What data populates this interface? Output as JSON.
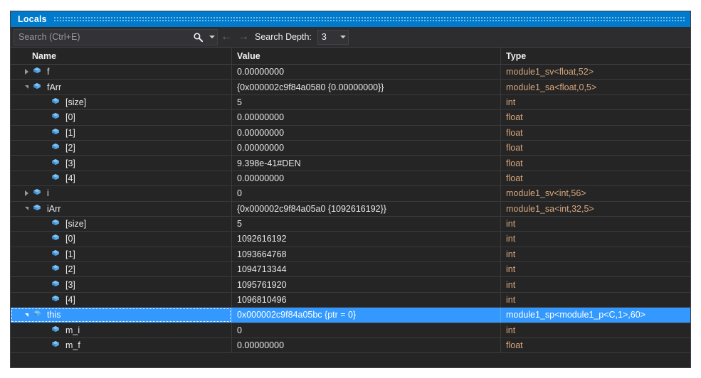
{
  "window": {
    "title": "Locals",
    "accent_color": "#007acc",
    "background_color": "#252526",
    "selection_color": "#3399ff",
    "type_text_color": "#d6a67b"
  },
  "toolbar": {
    "search_placeholder": "Search (Ctrl+E)",
    "search_value": "",
    "search_icon": "search-icon",
    "search_dropdown_icon": "chevron-down-icon",
    "back_arrow": "←",
    "forward_arrow": "→",
    "depth_label": "Search Depth:",
    "depth_value": "3",
    "depth_dropdown_icon": "chevron-down-icon"
  },
  "grid": {
    "columns": [
      "Name",
      "Value",
      "Type"
    ],
    "rows": [
      {
        "name": "f",
        "value": "0.00000000",
        "type": "module1_sv<float,52>",
        "indent": 0,
        "expander": "collapsed",
        "icon": "variable-cube-icon",
        "selected": false
      },
      {
        "name": "fArr",
        "value": "{0x000002c9f84a0580 {0.00000000}}",
        "type": "module1_sa<float,0,5>",
        "indent": 0,
        "expander": "expanded",
        "icon": "variable-cube-icon",
        "selected": false
      },
      {
        "name": "[size]",
        "value": "5",
        "type": "int",
        "indent": 1,
        "expander": "none",
        "icon": "variable-cube-icon",
        "selected": false
      },
      {
        "name": "[0]",
        "value": "0.00000000",
        "type": "float",
        "indent": 1,
        "expander": "none",
        "icon": "variable-cube-icon",
        "selected": false
      },
      {
        "name": "[1]",
        "value": "0.00000000",
        "type": "float",
        "indent": 1,
        "expander": "none",
        "icon": "variable-cube-icon",
        "selected": false
      },
      {
        "name": "[2]",
        "value": "0.00000000",
        "type": "float",
        "indent": 1,
        "expander": "none",
        "icon": "variable-cube-icon",
        "selected": false
      },
      {
        "name": "[3]",
        "value": "9.398e-41#DEN",
        "type": "float",
        "indent": 1,
        "expander": "none",
        "icon": "variable-cube-icon",
        "selected": false
      },
      {
        "name": "[4]",
        "value": "0.00000000",
        "type": "float",
        "indent": 1,
        "expander": "none",
        "icon": "variable-cube-icon",
        "selected": false
      },
      {
        "name": "i",
        "value": "0",
        "type": "module1_sv<int,56>",
        "indent": 0,
        "expander": "collapsed",
        "icon": "variable-cube-icon",
        "selected": false
      },
      {
        "name": "iArr",
        "value": "{0x000002c9f84a05a0 {1092616192}}",
        "type": "module1_sa<int,32,5>",
        "indent": 0,
        "expander": "expanded",
        "icon": "variable-cube-icon",
        "selected": false
      },
      {
        "name": "[size]",
        "value": "5",
        "type": "int",
        "indent": 1,
        "expander": "none",
        "icon": "variable-cube-icon",
        "selected": false
      },
      {
        "name": "[0]",
        "value": "1092616192",
        "type": "int",
        "indent": 1,
        "expander": "none",
        "icon": "variable-cube-icon",
        "selected": false
      },
      {
        "name": "[1]",
        "value": "1093664768",
        "type": "int",
        "indent": 1,
        "expander": "none",
        "icon": "variable-cube-icon",
        "selected": false
      },
      {
        "name": "[2]",
        "value": "1094713344",
        "type": "int",
        "indent": 1,
        "expander": "none",
        "icon": "variable-cube-icon",
        "selected": false
      },
      {
        "name": "[3]",
        "value": "1095761920",
        "type": "int",
        "indent": 1,
        "expander": "none",
        "icon": "variable-cube-icon",
        "selected": false
      },
      {
        "name": "[4]",
        "value": "1096810496",
        "type": "int",
        "indent": 1,
        "expander": "none",
        "icon": "variable-cube-icon",
        "selected": false
      },
      {
        "name": "this",
        "value": "0x000002c9f84a05bc {ptr = 0}",
        "type": "module1_sp<module1_p<C,1>,60>",
        "indent": 0,
        "expander": "expanded",
        "icon": "variable-cube-icon",
        "selected": true
      },
      {
        "name": "m_i",
        "value": "0",
        "type": "int",
        "indent": 1,
        "expander": "none",
        "icon": "variable-cube-icon",
        "selected": false
      },
      {
        "name": "m_f",
        "value": "0.00000000",
        "type": "float",
        "indent": 1,
        "expander": "none",
        "icon": "variable-cube-icon",
        "selected": false
      }
    ]
  }
}
